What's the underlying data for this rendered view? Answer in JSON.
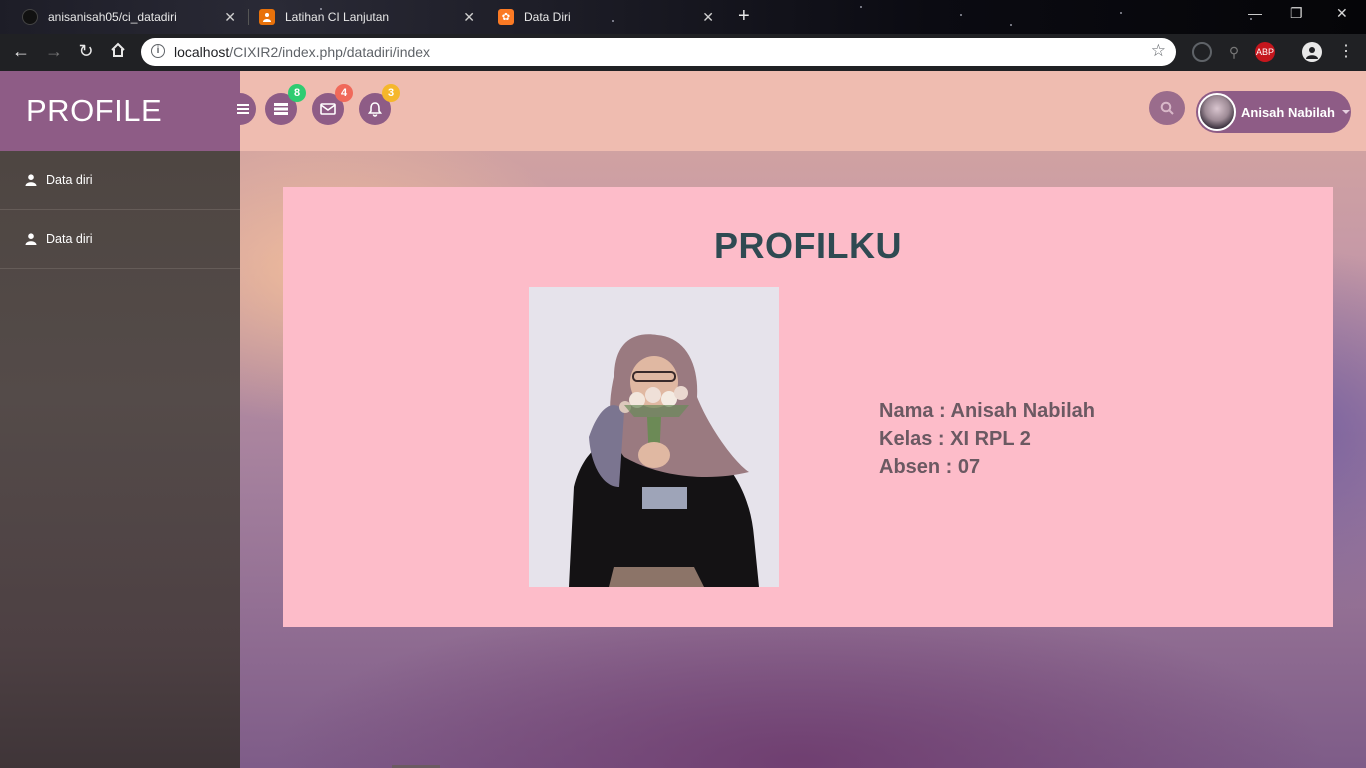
{
  "browser": {
    "tabs": [
      {
        "title": "anisanisah05/ci_datadiri",
        "icon": "github-icon"
      },
      {
        "title": "Latihan CI Lanjutan",
        "icon": "person-icon"
      },
      {
        "title": "Data Diri",
        "icon": "xampp-icon",
        "active": true
      }
    ],
    "url_host": "localhost",
    "url_path": "/CIXIR2/index.php/datadiri/index",
    "extensions": {
      "abp_label": "ABP"
    }
  },
  "app": {
    "brand": "PROFILE",
    "notifications": [
      {
        "icon": "list-icon",
        "count": "8",
        "color": "#2ecc71"
      },
      {
        "icon": "envelope-icon",
        "count": "4",
        "color": "#f0695a"
      },
      {
        "icon": "bell-icon",
        "count": "3",
        "color": "#f5b72c"
      }
    ],
    "user_name": "Anisah Nabilah"
  },
  "sidebar": {
    "items": [
      {
        "label": "Data diri",
        "icon": "user-icon"
      },
      {
        "label": "Data diri",
        "icon": "user-icon"
      }
    ]
  },
  "main": {
    "title": "PROFILKU",
    "details": [
      "Nama : Anisah Nabilah",
      "Kelas : XI RPL 2",
      "Absen : 07"
    ]
  }
}
